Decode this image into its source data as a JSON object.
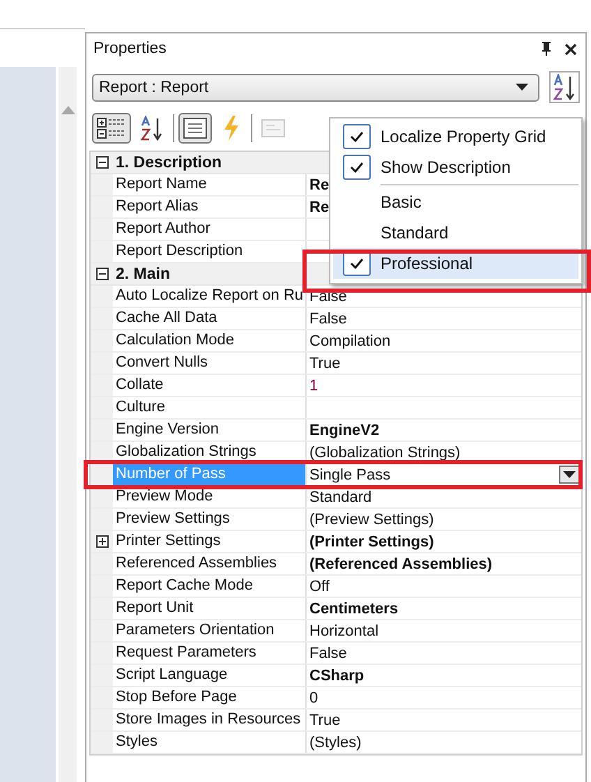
{
  "panel": {
    "title": "Properties",
    "object_selector": "Report : Report"
  },
  "toolbar": [
    {
      "kind": "categorized",
      "pressed": true,
      "disabled": false
    },
    {
      "kind": "alphabetical",
      "pressed": false,
      "disabled": false
    },
    {
      "kind": "separator"
    },
    {
      "kind": "properties",
      "pressed": true,
      "disabled": false
    },
    {
      "kind": "events",
      "pressed": false,
      "disabled": false
    },
    {
      "kind": "separator"
    },
    {
      "kind": "pages",
      "pressed": false,
      "disabled": true
    }
  ],
  "categories": [
    {
      "title": "1. Description",
      "expanded": true,
      "rows": [
        {
          "name": "Report Name",
          "value": "Re",
          "kind": "bold",
          "selected": false
        },
        {
          "name": "Report Alias",
          "value": "Re",
          "kind": "bold",
          "selected": false
        },
        {
          "name": "Report Author",
          "selected": false
        },
        {
          "name": "Report Description",
          "selected": false
        }
      ]
    },
    {
      "title": "2. Main",
      "expanded": true,
      "rows": [
        {
          "name": "Auto Localize Report on Ru",
          "value": "False",
          "kind": "plain",
          "selected": false
        },
        {
          "name": "Cache All Data",
          "value": "False",
          "kind": "plain",
          "selected": false
        },
        {
          "name": "Calculation Mode",
          "value": "Compilation",
          "kind": "plain",
          "selected": false
        },
        {
          "name": "Convert Nulls",
          "value": "True",
          "kind": "plain",
          "selected": false
        },
        {
          "name": "Collate",
          "value": "1",
          "kind": "modified",
          "selected": false
        },
        {
          "name": "Culture",
          "selected": false
        },
        {
          "name": "Engine Version",
          "value": "EngineV2",
          "kind": "bold",
          "selected": false
        },
        {
          "name": "Globalization Strings",
          "value": "(Globalization Strings)",
          "kind": "plain",
          "selected": false
        },
        {
          "name": "Number of Pass",
          "value": "Single Pass",
          "kind": "plain",
          "selected": true
        },
        {
          "name": "Preview Mode",
          "value": "Standard",
          "kind": "plain",
          "selected": false
        },
        {
          "name": "Preview Settings",
          "value": "(Preview Settings)",
          "kind": "plain",
          "selected": false
        },
        {
          "name": "Printer Settings",
          "value": "(Printer Settings)",
          "kind": "bold",
          "selected": false,
          "expanded": false
        },
        {
          "name": "Referenced Assemblies",
          "value": "(Referenced Assemblies)",
          "kind": "bold",
          "selected": false
        },
        {
          "name": "Report Cache Mode",
          "value": "Off",
          "kind": "plain",
          "selected": false
        },
        {
          "name": "Report Unit",
          "value": "Centimeters",
          "kind": "bold",
          "selected": false
        },
        {
          "name": "Parameters Orientation",
          "value": "Horizontal",
          "kind": "plain",
          "selected": false
        },
        {
          "name": "Request Parameters",
          "value": "False",
          "kind": "plain",
          "selected": false
        },
        {
          "name": "Script Language",
          "value": "CSharp",
          "kind": "bold",
          "selected": false
        },
        {
          "name": "Stop Before Page",
          "value": "0",
          "kind": "plain",
          "selected": false
        },
        {
          "name": "Store Images in Resources",
          "value": "True",
          "kind": "plain",
          "selected": false
        },
        {
          "name": "Styles",
          "value": "(Styles)",
          "kind": "plain",
          "selected": false
        }
      ]
    }
  ],
  "menu": {
    "items": [
      {
        "kind": "item",
        "label": "Localize Property Grid",
        "checked": true,
        "selected": false
      },
      {
        "kind": "item",
        "label": "Show Description",
        "checked": true,
        "selected": false
      },
      {
        "kind": "separator"
      },
      {
        "kind": "item",
        "label": "Basic",
        "checked": false,
        "selected": false
      },
      {
        "kind": "item",
        "label": "Standard",
        "checked": false,
        "selected": false
      },
      {
        "kind": "item",
        "label": "Professional",
        "checked": true,
        "selected": true
      }
    ]
  }
}
